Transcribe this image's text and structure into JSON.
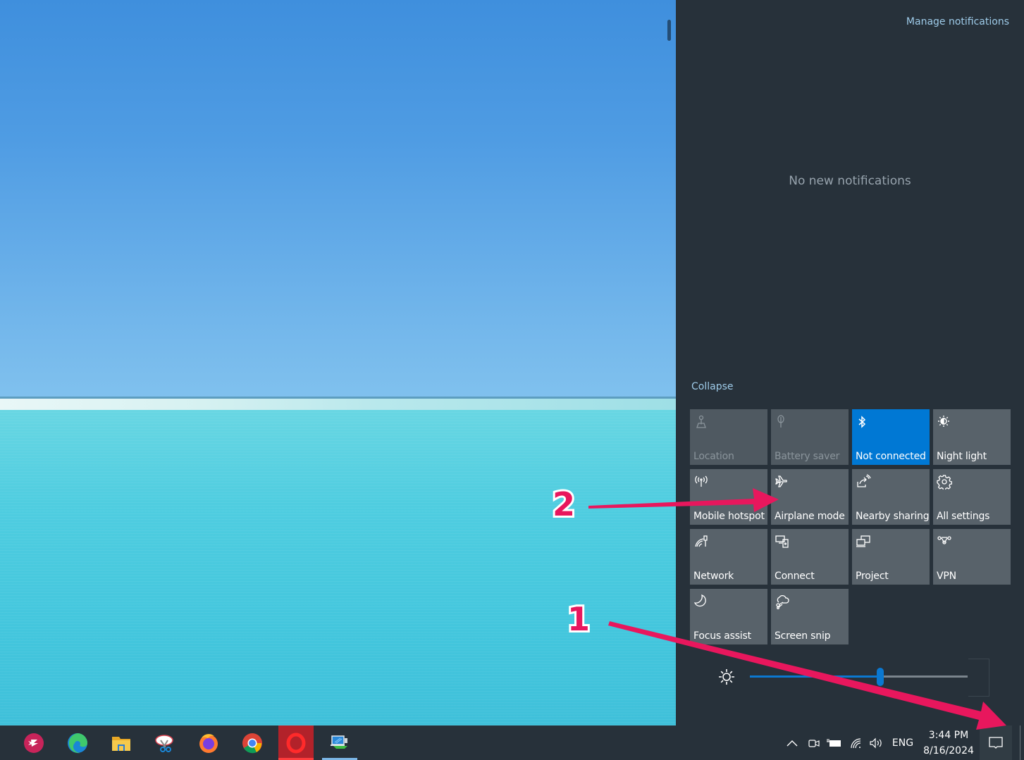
{
  "action_center": {
    "manage_notifications": "Manage notifications",
    "empty_state": "No new notifications",
    "collapse": "Collapse",
    "quick_actions": [
      {
        "label": "Location",
        "icon": "location-icon",
        "state": "disabled"
      },
      {
        "label": "Battery saver",
        "icon": "battery-saver-icon",
        "state": "disabled"
      },
      {
        "label": "Not connected",
        "icon": "bluetooth-icon",
        "state": "on"
      },
      {
        "label": "Night light",
        "icon": "night-light-icon",
        "state": "off"
      },
      {
        "label": "Mobile hotspot",
        "icon": "mobile-hotspot-icon",
        "state": "off"
      },
      {
        "label": "Airplane mode",
        "icon": "airplane-icon",
        "state": "off"
      },
      {
        "label": "Nearby sharing",
        "icon": "nearby-sharing-icon",
        "state": "off"
      },
      {
        "label": "All settings",
        "icon": "gear-icon",
        "state": "off"
      },
      {
        "label": "Network",
        "icon": "network-icon",
        "state": "off"
      },
      {
        "label": "Connect",
        "icon": "connect-icon",
        "state": "off"
      },
      {
        "label": "Project",
        "icon": "project-icon",
        "state": "off"
      },
      {
        "label": "VPN",
        "icon": "vpn-icon",
        "state": "off"
      },
      {
        "label": "Focus assist",
        "icon": "moon-icon",
        "state": "off"
      },
      {
        "label": "Screen snip",
        "icon": "screen-snip-icon",
        "state": "off"
      }
    ],
    "brightness": {
      "icon": "brightness-icon",
      "value_percent": 60
    }
  },
  "taskbar": {
    "apps": [
      {
        "name": "Skype",
        "icon": "skype-icon"
      },
      {
        "name": "Microsoft Edge",
        "icon": "edge-icon"
      },
      {
        "name": "File Explorer",
        "icon": "file-explorer-icon"
      },
      {
        "name": "Snipping Tool",
        "icon": "snipping-tool-icon"
      },
      {
        "name": "Firefox",
        "icon": "firefox-icon"
      },
      {
        "name": "Google Chrome",
        "icon": "chrome-icon"
      },
      {
        "name": "Opera",
        "icon": "opera-icon",
        "state": "active"
      },
      {
        "name": "Remote Desktop",
        "icon": "remote-desktop-icon",
        "state": "running"
      }
    ],
    "tray": {
      "language": "ENG",
      "time": "3:44 PM",
      "date": "8/16/2024"
    }
  },
  "annotations": {
    "step_1": "1",
    "step_2": "2",
    "color": "#e8175d"
  },
  "colors": {
    "panel_bg": "#27313a",
    "tile_bg": "#58626a",
    "accent": "#0078d4",
    "link": "#9ecbe9"
  }
}
